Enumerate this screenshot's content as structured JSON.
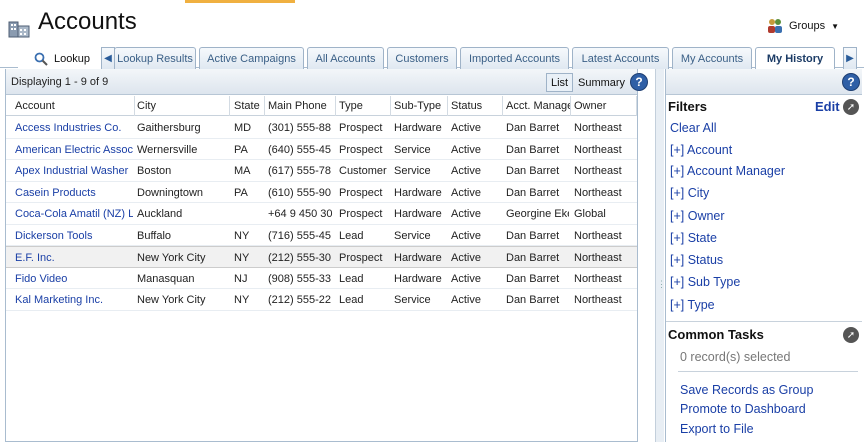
{
  "header": {
    "title": "Accounts",
    "groups_label": "Groups"
  },
  "tabs": {
    "items": [
      {
        "label": "Lookup"
      },
      {
        "label": "Lookup Results"
      },
      {
        "label": "Active Campaigns"
      },
      {
        "label": "All Accounts"
      },
      {
        "label": "Customers"
      },
      {
        "label": "Imported Accounts"
      },
      {
        "label": "Latest Accounts"
      },
      {
        "label": "My Accounts"
      },
      {
        "label": "My History"
      }
    ],
    "active": "My History"
  },
  "list": {
    "display_count": "Displaying 1 - 9 of 9",
    "view_list": "List",
    "view_summary": "Summary",
    "help": "?",
    "columns": [
      "Account",
      "City",
      "State",
      "Main Phone",
      "Type",
      "Sub-Type",
      "Status",
      "Acct. Manager",
      "Owner"
    ],
    "rows": [
      {
        "account": "Access Industries Co.",
        "city": "Gaithersburg",
        "state": "MD",
        "phone": "(301) 555-88",
        "type": "Prospect",
        "subtype": "Hardware",
        "status": "Active",
        "manager": "Dan Barret",
        "owner": "Northeast"
      },
      {
        "account": "American Electric Assoc",
        "city": "Wernersville",
        "state": "PA",
        "phone": "(640) 555-45",
        "type": "Prospect",
        "subtype": "Service",
        "status": "Active",
        "manager": "Dan Barret",
        "owner": "Northeast"
      },
      {
        "account": "Apex Industrial Washer",
        "city": "Boston",
        "state": "MA",
        "phone": "(617) 555-78",
        "type": "Customer",
        "subtype": "Service",
        "status": "Active",
        "manager": "Dan Barret",
        "owner": "Northeast"
      },
      {
        "account": "Casein Products",
        "city": "Downingtown",
        "state": "PA",
        "phone": "(610) 555-90",
        "type": "Prospect",
        "subtype": "Hardware",
        "status": "Active",
        "manager": "Dan Barret",
        "owner": "Northeast"
      },
      {
        "account": "Coca-Cola Amatil (NZ) Lt",
        "city": "Auckland",
        "state": "",
        "phone": "+64 9 450 30",
        "type": "Prospect",
        "subtype": "Hardware",
        "status": "Active",
        "manager": "Georgine Eke",
        "owner": "Global"
      },
      {
        "account": "Dickerson Tools",
        "city": "Buffalo",
        "state": "NY",
        "phone": "(716) 555-45",
        "type": "Lead",
        "subtype": "Service",
        "status": "Active",
        "manager": "Dan Barret",
        "owner": "Northeast"
      },
      {
        "account": "E.F. Inc.",
        "city": "New York City",
        "state": "NY",
        "phone": "(212) 555-30",
        "type": "Prospect",
        "subtype": "Hardware",
        "status": "Active",
        "manager": "Dan Barret",
        "owner": "Northeast"
      },
      {
        "account": "Fido Video",
        "city": "Manasquan",
        "state": "NJ",
        "phone": "(908) 555-33",
        "type": "Lead",
        "subtype": "Hardware",
        "status": "Active",
        "manager": "Dan Barret",
        "owner": "Northeast"
      },
      {
        "account": "Kal Marketing Inc.",
        "city": "New York City",
        "state": "NY",
        "phone": "(212) 555-22",
        "type": "Lead",
        "subtype": "Service",
        "status": "Active",
        "manager": "Dan Barret",
        "owner": "Northeast"
      }
    ]
  },
  "filters": {
    "title": "Filters",
    "edit_label": "Edit",
    "clear_all": "Clear All",
    "items": [
      "[+] Account",
      "[+] Account Manager",
      "[+] City",
      "[+] Owner",
      "[+] State",
      "[+] Status",
      "[+] Sub Type",
      "[+] Type"
    ]
  },
  "tasks": {
    "title": "Common Tasks",
    "selected_text": "0 record(s) selected",
    "items": [
      "Save Records as Group",
      "Promote to Dashboard",
      "Export to File"
    ]
  },
  "icons": {
    "app": "accounts-building-icon",
    "groups": "groups-people-icon",
    "lookup": "magnifier-icon",
    "help": "help-icon",
    "arrow": "go-arrow-icon"
  }
}
